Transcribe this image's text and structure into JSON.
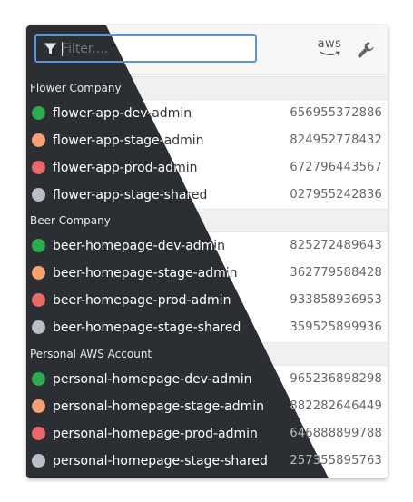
{
  "filter": {
    "placeholder": "Filter...."
  },
  "header": {
    "aws_logo_text": "aws"
  },
  "groups": [
    {
      "title": "Flower Company",
      "accounts": [
        {
          "name": "flower-app-dev-admin",
          "id": "656955372886",
          "color": "green"
        },
        {
          "name": "flower-app-stage-admin",
          "id": "824952778432",
          "color": "orange"
        },
        {
          "name": "flower-app-prod-admin",
          "id": "672796443567",
          "color": "red"
        },
        {
          "name": "flower-app-stage-shared",
          "id": "027955242836",
          "color": "gray"
        }
      ]
    },
    {
      "title": "Beer Company",
      "accounts": [
        {
          "name": "beer-homepage-dev-admin",
          "id": "825272489643",
          "color": "green"
        },
        {
          "name": "beer-homepage-stage-admin",
          "id": "362779588428",
          "color": "orange"
        },
        {
          "name": "beer-homepage-prod-admin",
          "id": "933858936953",
          "color": "red"
        },
        {
          "name": "beer-homepage-stage-shared",
          "id": "359525899936",
          "color": "gray"
        }
      ]
    },
    {
      "title": "Personal AWS Account",
      "accounts": [
        {
          "name": "personal-homepage-dev-admin",
          "id": "965236898298",
          "color": "green"
        },
        {
          "name": "personal-homepage-stage-admin",
          "id": "882282646449",
          "color": "orange"
        },
        {
          "name": "personal-homepage-prod-admin",
          "id": "646888899788",
          "color": "red"
        },
        {
          "name": "personal-homepage-stage-shared",
          "id": "257355895763",
          "color": "gray"
        }
      ]
    }
  ],
  "colors": {
    "green": "#2eaa4f",
    "orange": "#f7a072",
    "red": "#ea6a6a",
    "gray": "#b9bec6",
    "dark_theme_bg": "#2b2e33",
    "filter_border": "#5a95d6"
  }
}
